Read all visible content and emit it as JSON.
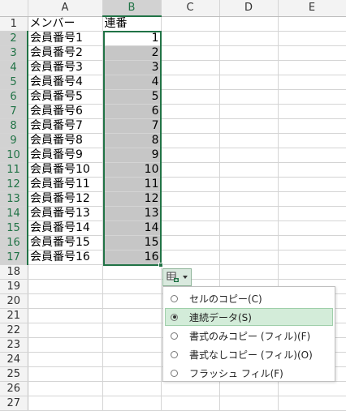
{
  "columns": [
    "",
    "A",
    "B",
    "C",
    "D",
    "E"
  ],
  "rows": [
    {
      "num": "1",
      "a": "メンバー",
      "b": "連番"
    },
    {
      "num": "2",
      "a": "会員番号1",
      "b": "1"
    },
    {
      "num": "3",
      "a": "会員番号2",
      "b": "2"
    },
    {
      "num": "4",
      "a": "会員番号3",
      "b": "3"
    },
    {
      "num": "5",
      "a": "会員番号4",
      "b": "4"
    },
    {
      "num": "6",
      "a": "会員番号5",
      "b": "5"
    },
    {
      "num": "7",
      "a": "会員番号6",
      "b": "6"
    },
    {
      "num": "8",
      "a": "会員番号7",
      "b": "7"
    },
    {
      "num": "9",
      "a": "会員番号8",
      "b": "8"
    },
    {
      "num": "10",
      "a": "会員番号9",
      "b": "9"
    },
    {
      "num": "11",
      "a": "会員番号10",
      "b": "10"
    },
    {
      "num": "12",
      "a": "会員番号11",
      "b": "11"
    },
    {
      "num": "13",
      "a": "会員番号12",
      "b": "12"
    },
    {
      "num": "14",
      "a": "会員番号13",
      "b": "13"
    },
    {
      "num": "15",
      "a": "会員番号14",
      "b": "14"
    },
    {
      "num": "16",
      "a": "会員番号15",
      "b": "15"
    },
    {
      "num": "17",
      "a": "会員番号16",
      "b": "16"
    },
    {
      "num": "18",
      "a": "",
      "b": ""
    },
    {
      "num": "19",
      "a": "",
      "b": ""
    },
    {
      "num": "20",
      "a": "",
      "b": ""
    },
    {
      "num": "21",
      "a": "",
      "b": ""
    },
    {
      "num": "22",
      "a": "",
      "b": ""
    },
    {
      "num": "23",
      "a": "",
      "b": ""
    },
    {
      "num": "24",
      "a": "",
      "b": ""
    },
    {
      "num": "25",
      "a": "",
      "b": ""
    },
    {
      "num": "26",
      "a": "",
      "b": ""
    },
    {
      "num": "27",
      "a": "",
      "b": ""
    }
  ],
  "autofill_menu": {
    "icon": "autofill-options-icon",
    "items": [
      {
        "label": "セルのコピー(C)",
        "checked": false,
        "highlight": false
      },
      {
        "label": "連続データ(S)",
        "checked": true,
        "highlight": true
      },
      {
        "label": "書式のみコピー (フィル)(F)",
        "checked": false,
        "highlight": false
      },
      {
        "label": "書式なしコピー (フィル)(O)",
        "checked": false,
        "highlight": false
      },
      {
        "label": "フラッシュ フィル(F)",
        "checked": false,
        "highlight": false
      }
    ]
  },
  "colors": {
    "selection_accent": "#217346",
    "selected_fill": "#c6c6c6",
    "menu_highlight": "#d3ecd9"
  }
}
